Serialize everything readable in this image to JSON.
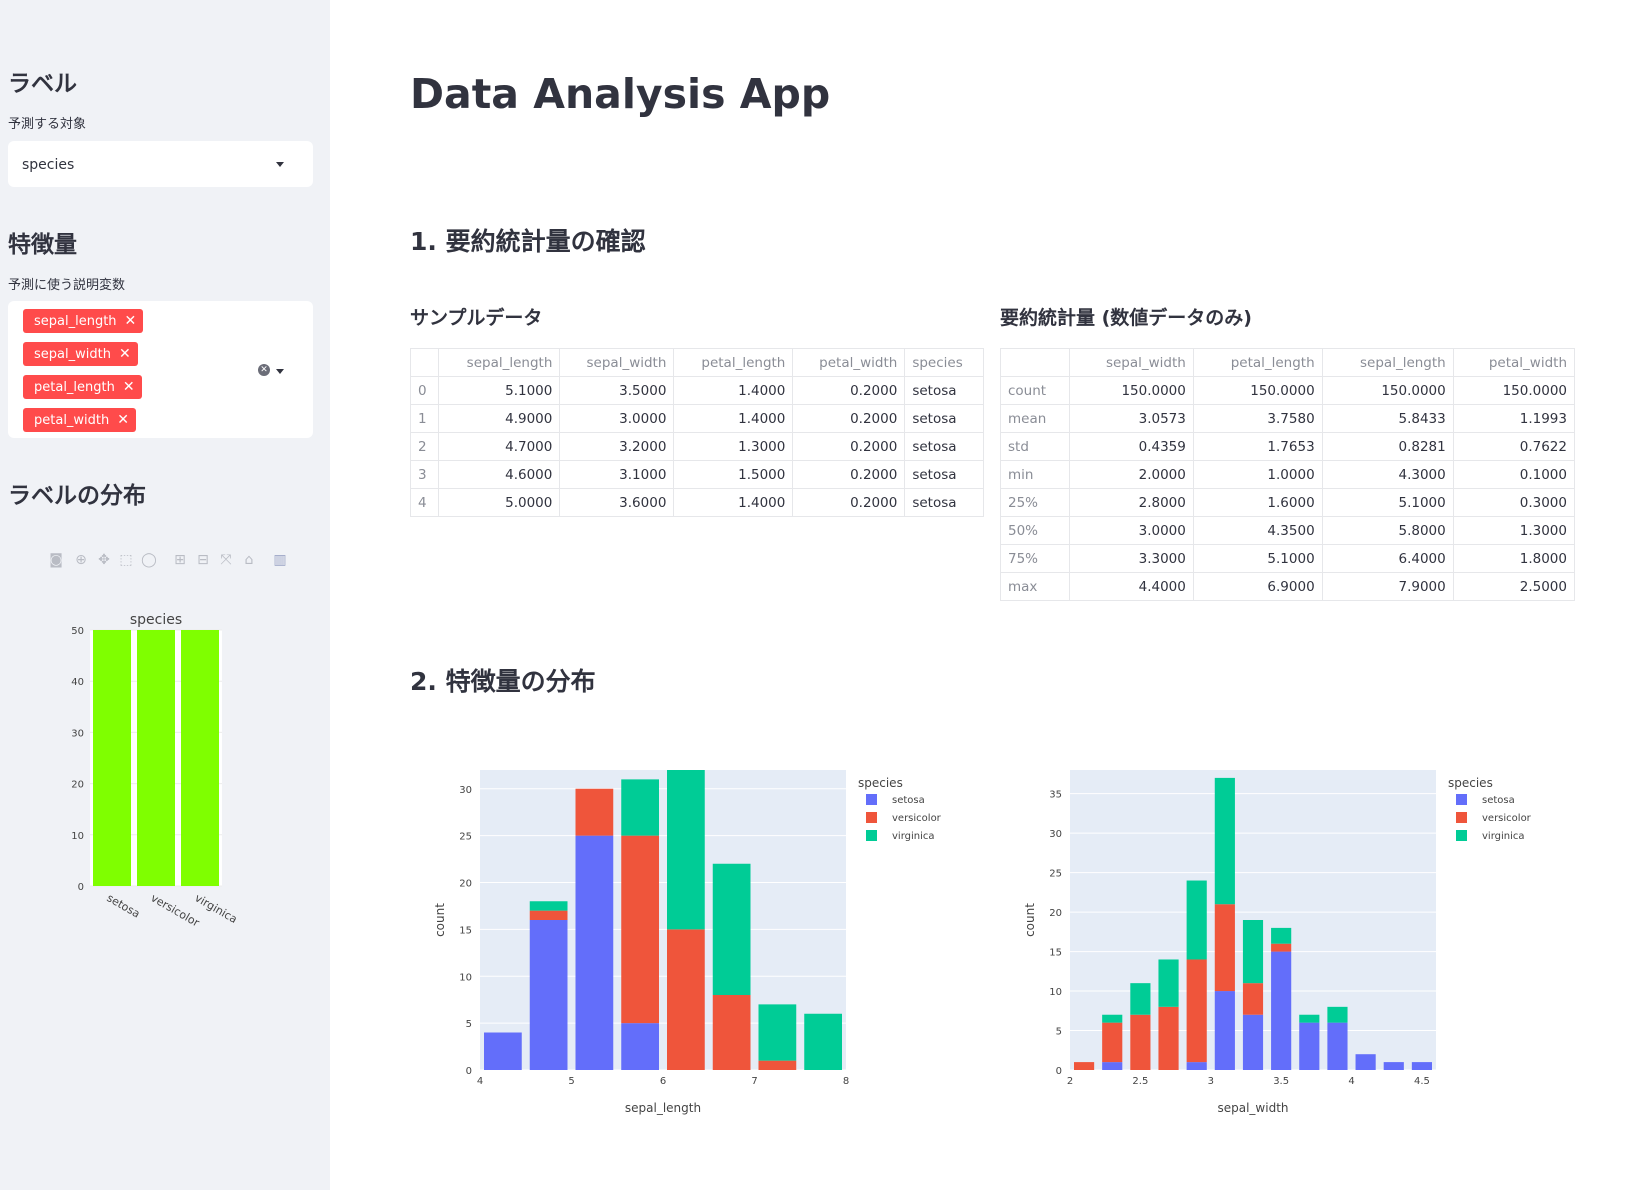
{
  "sidebar": {
    "label_heading": "ラベル",
    "label_caption": "予測する対象",
    "label_select_value": "species",
    "feature_heading": "特徴量",
    "feature_caption": "予測に使う説明変数",
    "feature_tags": [
      "sepal_length",
      "sepal_width",
      "petal_length",
      "petal_width"
    ],
    "dist_heading": "ラベルの分布",
    "toolbar_icons": [
      "camera-icon",
      "zoom-icon",
      "pan-icon",
      "box-select-icon",
      "lasso-icon",
      "zoom-in-icon",
      "zoom-out-icon",
      "autoscale-icon",
      "reset-axes-icon",
      "plotly-logo-icon"
    ]
  },
  "main": {
    "title": "Data Analysis App",
    "section1": "1. 要約統計量の確認",
    "sample_heading": "サンプルデータ",
    "summary_heading": "要約統計量 (数値データのみ)",
    "section2": "2. 特徴量の分布"
  },
  "sample_table": {
    "columns": [
      "",
      "sepal_length",
      "sepal_width",
      "petal_length",
      "petal_width",
      "species"
    ],
    "rows": [
      [
        "0",
        "5.1000",
        "3.5000",
        "1.4000",
        "0.2000",
        "setosa"
      ],
      [
        "1",
        "4.9000",
        "3.0000",
        "1.4000",
        "0.2000",
        "setosa"
      ],
      [
        "2",
        "4.7000",
        "3.2000",
        "1.3000",
        "0.2000",
        "setosa"
      ],
      [
        "3",
        "4.6000",
        "3.1000",
        "1.5000",
        "0.2000",
        "setosa"
      ],
      [
        "4",
        "5.0000",
        "3.6000",
        "1.4000",
        "0.2000",
        "setosa"
      ]
    ]
  },
  "summary_table": {
    "columns": [
      "",
      "sepal_width",
      "petal_length",
      "sepal_length",
      "petal_width"
    ],
    "rows": [
      [
        "count",
        "150.0000",
        "150.0000",
        "150.0000",
        "150.0000"
      ],
      [
        "mean",
        "3.0573",
        "3.7580",
        "5.8433",
        "1.1993"
      ],
      [
        "std",
        "0.4359",
        "1.7653",
        "0.8281",
        "0.7622"
      ],
      [
        "min",
        "2.0000",
        "1.0000",
        "4.3000",
        "0.1000"
      ],
      [
        "25%",
        "2.8000",
        "1.6000",
        "5.1000",
        "0.3000"
      ],
      [
        "50%",
        "3.0000",
        "4.3500",
        "5.8000",
        "1.3000"
      ],
      [
        "75%",
        "3.3000",
        "5.1000",
        "6.4000",
        "1.8000"
      ],
      [
        "max",
        "4.4000",
        "6.9000",
        "7.9000",
        "2.5000"
      ]
    ]
  },
  "colors": {
    "setosa": "#636efa",
    "versicolor": "#ef553b",
    "virginica": "#00cc96",
    "label_bar": "#7fff00",
    "accent": "#ff4b4b"
  },
  "chart_data": [
    {
      "type": "bar",
      "title": "species",
      "categories": [
        "setosa",
        "versicolor",
        "virginica"
      ],
      "values": [
        50,
        50,
        50
      ],
      "ylim": [
        0,
        50
      ],
      "yticks": [
        0,
        10,
        20,
        30,
        40,
        50
      ]
    },
    {
      "type": "bar",
      "stacked": true,
      "xlabel": "sepal_length",
      "ylabel": "count",
      "legend_title": "species",
      "xlim": [
        4,
        8
      ],
      "ylim": [
        0,
        32
      ],
      "xticks": [
        4,
        5,
        6,
        7,
        8
      ],
      "yticks": [
        0,
        5,
        10,
        15,
        20,
        25,
        30
      ],
      "bin_edges": [
        4,
        4.5,
        5,
        5.5,
        6,
        6.5,
        7,
        7.5,
        8
      ],
      "series": [
        {
          "name": "setosa",
          "values": [
            4,
            16,
            25,
            5,
            0,
            0,
            0,
            0
          ]
        },
        {
          "name": "versicolor",
          "values": [
            0,
            1,
            5,
            20,
            15,
            8,
            1,
            0
          ]
        },
        {
          "name": "virginica",
          "values": [
            0,
            1,
            0,
            6,
            17,
            14,
            6,
            6
          ]
        }
      ]
    },
    {
      "type": "bar",
      "stacked": true,
      "xlabel": "sepal_width",
      "ylabel": "count",
      "legend_title": "species",
      "xlim": [
        2,
        4.6
      ],
      "ylim": [
        0,
        38
      ],
      "xticks": [
        2,
        2.5,
        3,
        3.5,
        4,
        4.5
      ],
      "yticks": [
        0,
        5,
        10,
        15,
        20,
        25,
        30,
        35
      ],
      "bin_edges": [
        2,
        2.2,
        2.4,
        2.6,
        2.8,
        3,
        3.2,
        3.4,
        3.6,
        3.8,
        4,
        4.2,
        4.4,
        4.6
      ],
      "series": [
        {
          "name": "setosa",
          "values": [
            0,
            1,
            0,
            0,
            1,
            10,
            7,
            15,
            6,
            6,
            2,
            1,
            1
          ]
        },
        {
          "name": "versicolor",
          "values": [
            1,
            5,
            7,
            8,
            13,
            11,
            4,
            1,
            0,
            0,
            0,
            0,
            0
          ]
        },
        {
          "name": "virginica",
          "values": [
            0,
            1,
            4,
            6,
            10,
            16,
            8,
            2,
            1,
            2,
            0,
            0,
            0
          ]
        }
      ]
    }
  ]
}
